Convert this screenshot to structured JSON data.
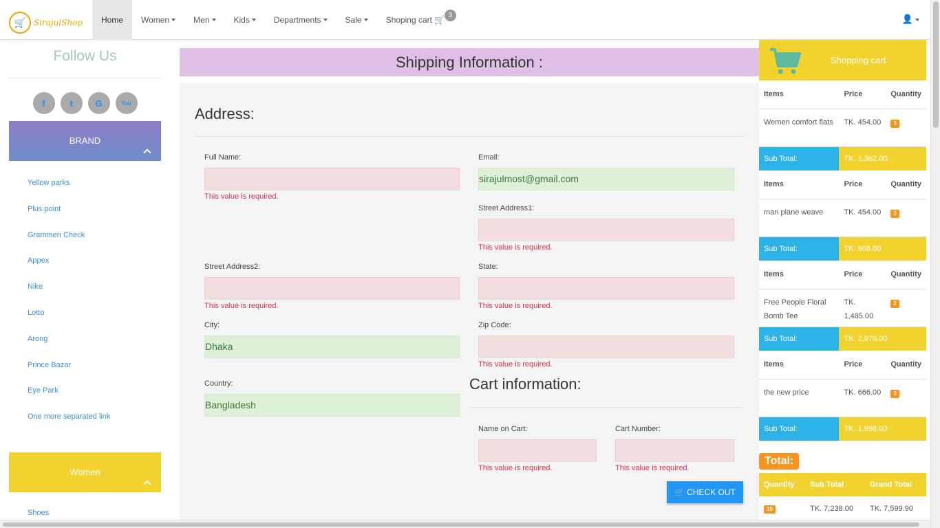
{
  "brand": {
    "name": "SirajulShop"
  },
  "nav": {
    "items": [
      "Home",
      "Women",
      "Men",
      "Kids",
      "Departments",
      "Sale"
    ],
    "cart_label": "Shoping cart",
    "cart_count": "3"
  },
  "sidebar": {
    "follow_title": "Follow Us",
    "social": [
      "f",
      "t",
      "G",
      "You"
    ],
    "brand_panel": "BRAND",
    "brands": [
      "Yellow parks",
      "Plus point",
      "Grammen Check",
      "Appex",
      "Nike",
      "Lotto",
      "Arong",
      "Prince Bazar",
      "Eye Park",
      "One more separated link"
    ],
    "women_panel": "Women",
    "women_items": [
      "Shoes"
    ]
  },
  "main": {
    "header": "Shipping Information :",
    "address_title": "Address:",
    "cart_info_title": "Cart information:",
    "error_text": "This value is required.",
    "fields": {
      "full_name": {
        "label": "Full Name:",
        "value": ""
      },
      "email": {
        "label": "Email:",
        "value": "sirajulmost@gmail.com"
      },
      "street1": {
        "label": "Street Address1:",
        "value": ""
      },
      "street2": {
        "label": "Street Address2:",
        "value": ""
      },
      "state": {
        "label": "State:",
        "value": ""
      },
      "city": {
        "label": "City:",
        "value": "Dhaka"
      },
      "zip": {
        "label": "Zip Code:",
        "value": ""
      },
      "country": {
        "label": "Country:",
        "value": "Bangladesh"
      },
      "name_on_cart": {
        "label": "Name on Cart:",
        "value": ""
      },
      "cart_number": {
        "label": "Cart Number:",
        "value": ""
      }
    },
    "checkout_label": "CHECK OUT"
  },
  "cart": {
    "title": "Shopping cart",
    "col_items": "Items",
    "col_price": "Price",
    "col_quantity": "Quantity",
    "subtotal_label": "Sub Total:",
    "items": [
      {
        "name": "Wemen comfort flats",
        "price": "TK. 454.00",
        "qty": "3",
        "subtotal": "TK. 1,362.00"
      },
      {
        "name": "man plane weave",
        "price": "TK. 454.00",
        "qty": "2",
        "subtotal": "TK. 908.00"
      },
      {
        "name": "Free People Floral Bomb Tee",
        "price": "TK. 1,485.00",
        "qty": "2",
        "subtotal": "TK. 2,970.00"
      },
      {
        "name": "the new price",
        "price": "TK. 666.00",
        "qty": "3",
        "subtotal": "TK. 1,998.00"
      }
    ],
    "total_label": "Total:",
    "total_cols": [
      "Quantity",
      "Sub Total",
      "Grand Total"
    ],
    "total_qty": "10",
    "total_subtotal": "TK. 7,238.00",
    "total_grand": "TK. 7,599.90"
  },
  "colors": {
    "accent_yellow": "#f2d22e",
    "accent_blue": "#2db2e8",
    "error_red": "#d9304f",
    "ok_green": "#3c763d",
    "purple_header": "#e0bfe6"
  }
}
